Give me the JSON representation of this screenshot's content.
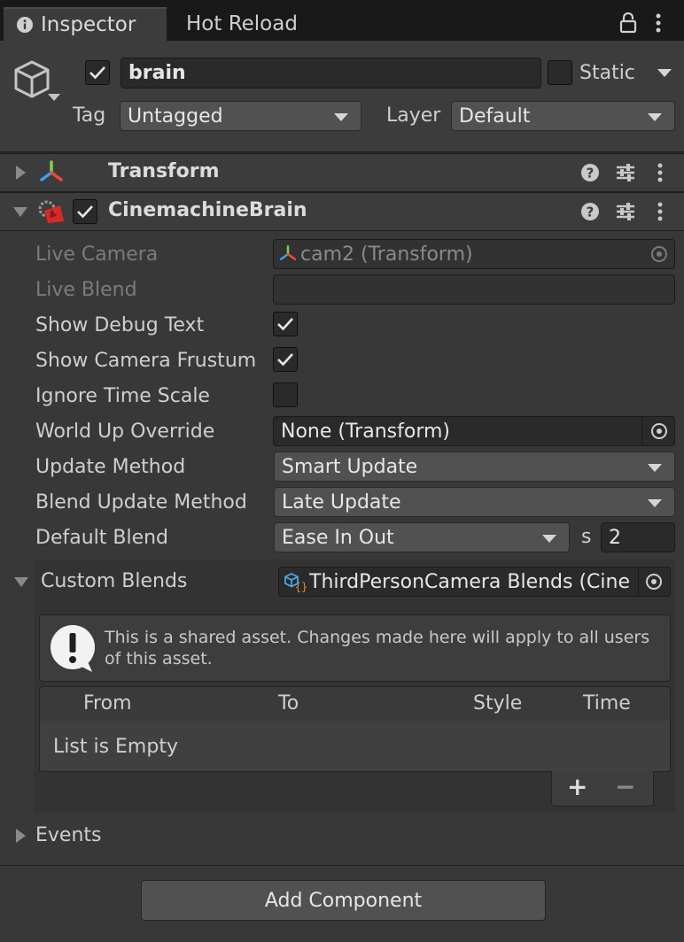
{
  "tabs": {
    "inspector": "Inspector",
    "hot_reload": "Hot Reload"
  },
  "header": {
    "object_name": "brain",
    "static_label": "Static",
    "tag_label": "Tag",
    "tag_value": "Untagged",
    "layer_label": "Layer",
    "layer_value": "Default"
  },
  "components": {
    "transform": {
      "title": "Transform"
    },
    "brain": {
      "title": "CinemachineBrain"
    }
  },
  "brain_fields": {
    "live_camera_label": "Live Camera",
    "live_camera_value": "cam2 (Transform)",
    "live_blend_label": "Live Blend",
    "live_blend_value": "",
    "show_debug_text_label": "Show Debug Text",
    "show_debug_text_checked": true,
    "show_camera_frustum_label": "Show Camera Frustum",
    "show_camera_frustum_checked": true,
    "ignore_time_scale_label": "Ignore Time Scale",
    "ignore_time_scale_checked": false,
    "world_up_override_label": "World Up Override",
    "world_up_override_value": "None (Transform)",
    "update_method_label": "Update Method",
    "update_method_value": "Smart Update",
    "blend_update_method_label": "Blend Update Method",
    "blend_update_method_value": "Late Update",
    "default_blend_label": "Default Blend",
    "default_blend_value": "Ease In Out",
    "default_blend_unit": "s",
    "default_blend_time": "2",
    "custom_blends_label": "Custom Blends",
    "custom_blends_value": "ThirdPersonCamera Blends (Cine"
  },
  "help_box": {
    "message": "This is a shared asset.  Changes made here will apply to all users of this asset."
  },
  "blend_list": {
    "columns": [
      "From",
      "To",
      "Style",
      "Time"
    ],
    "empty_text": "List is Empty",
    "add": "+",
    "remove": "−"
  },
  "events_label": "Events",
  "add_component_label": "Add Component",
  "colors": {
    "background": "#383838",
    "header": "#3c3c3c",
    "field": "#2a2a2a",
    "dropdown": "#515151",
    "tabbar": "#191919",
    "brain_icon": "#d62a2a"
  }
}
